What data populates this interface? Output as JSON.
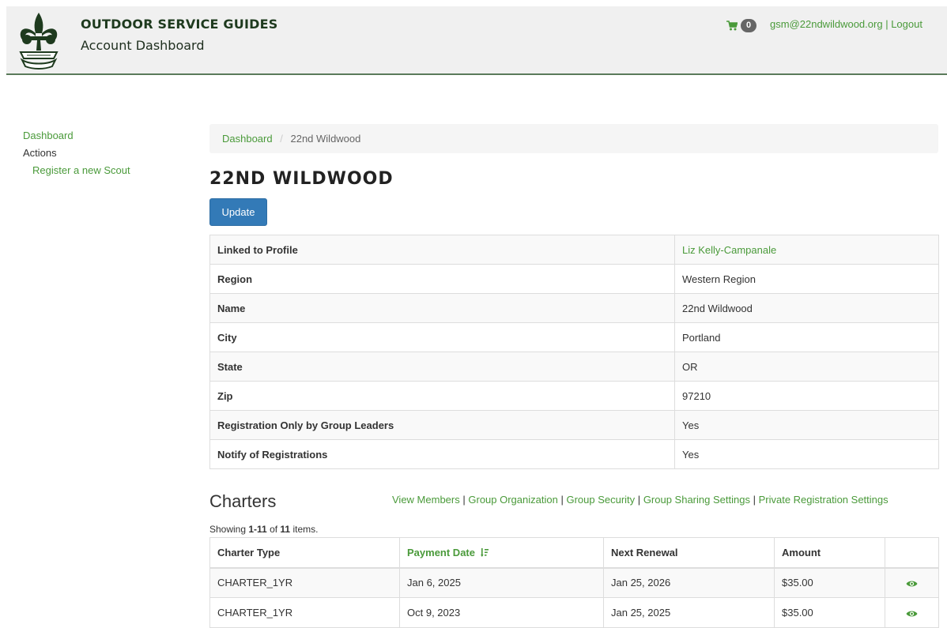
{
  "header": {
    "brand_title": "OUTDOOR SERVICE GUIDES",
    "subtitle": "Account Dashboard",
    "cart_count": "0",
    "user_email": "gsm@22ndwildwood.org",
    "separator": "|",
    "logout_label": "Logout"
  },
  "sidebar": {
    "dashboard_label": "Dashboard",
    "actions_label": "Actions",
    "register_label": "Register a new Scout"
  },
  "breadcrumb": {
    "home": "Dashboard",
    "separator": "/",
    "current": "22nd Wildwood"
  },
  "page_title": "22ND WILDWOOD",
  "update_button": "Update",
  "details": [
    {
      "label": "Linked to Profile",
      "value": "Liz Kelly-Campanale",
      "is_link": true
    },
    {
      "label": "Region",
      "value": "Western Region"
    },
    {
      "label": "Name",
      "value": "22nd Wildwood"
    },
    {
      "label": "City",
      "value": "Portland"
    },
    {
      "label": "State",
      "value": "OR"
    },
    {
      "label": "Zip",
      "value": "97210"
    },
    {
      "label": "Registration Only by Group Leaders",
      "value": "Yes"
    },
    {
      "label": "Notify of Registrations",
      "value": "Yes"
    }
  ],
  "charters": {
    "title": "Charters",
    "links": {
      "view_members": "View Members",
      "group_organization": "Group Organization",
      "group_security": "Group Security",
      "group_sharing": "Group Sharing Settings",
      "private_registration": "Private Registration Settings",
      "separator": "|"
    },
    "summary": {
      "prefix": "Showing ",
      "range": "1-11",
      "middle": " of ",
      "total": "11",
      "suffix": " items."
    },
    "columns": [
      "Charter Type",
      "Payment Date",
      "Next Renewal",
      "Amount"
    ],
    "rows": [
      {
        "type": "CHARTER_1YR",
        "payment_date": "Jan 6, 2025",
        "next_renewal": "Jan 25, 2026",
        "amount": "$35.00"
      },
      {
        "type": "CHARTER_1YR",
        "payment_date": "Oct 9, 2023",
        "next_renewal": "Jan 25, 2025",
        "amount": "$35.00"
      }
    ]
  },
  "colors": {
    "link_green": "#4a9a3a",
    "primary_blue": "#337ab7",
    "header_bg": "#f0f0f0"
  },
  "icons": {
    "logo": "fleur-de-lis-logo",
    "cart": "cart-icon",
    "sort": "sort-amount-desc-icon",
    "view": "eye-icon"
  }
}
